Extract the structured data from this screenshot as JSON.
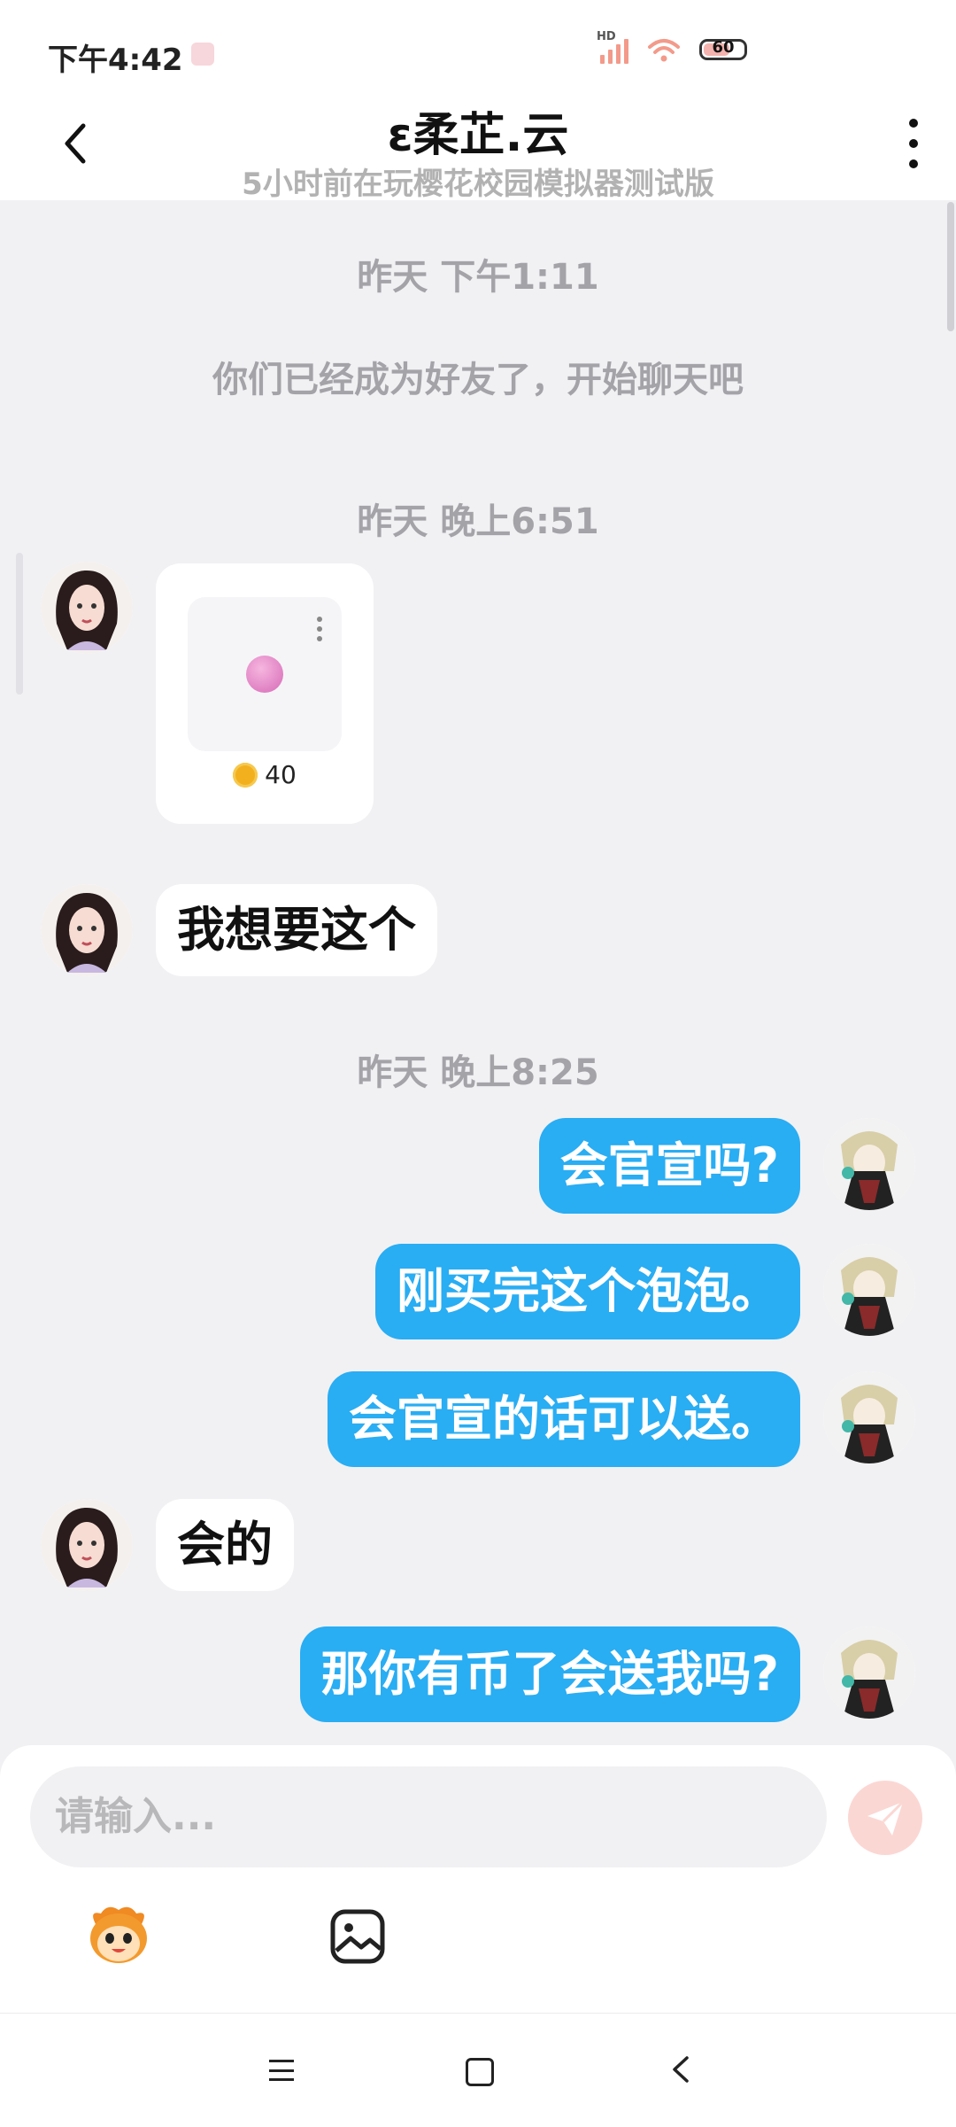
{
  "status_bar": {
    "time": "下午4:42",
    "signal_label": "HD",
    "battery_level": "60"
  },
  "header": {
    "title": "ε柔芷.云",
    "subtitle": "5小时前在玩樱花校园模拟器测试版"
  },
  "messages": {
    "time_1": "昨天  下午1:11",
    "system_1": "你们已经成为好友了，开始聊天吧",
    "time_2": "昨天  晚上6:51",
    "gift_price": "40",
    "msg_1": "我想要这个",
    "time_3": "昨天  晚上8:25",
    "msg_2": "会官宣吗?",
    "msg_3": "刚买完这个泡泡。",
    "msg_4": "会官宣的话可以送。",
    "msg_5": "会的",
    "msg_6": "那你有币了会送我吗?"
  },
  "input": {
    "placeholder": "请输入..."
  },
  "colors": {
    "accent_blue": "#29adf3",
    "send_disabled": "#fbd7d3",
    "background": "#f1f1f4"
  },
  "icons": {
    "back": "back-arrow-icon",
    "more": "more-vertical-icon",
    "send": "send-icon",
    "emoji": "emoji-mascot-icon",
    "image": "image-icon"
  }
}
